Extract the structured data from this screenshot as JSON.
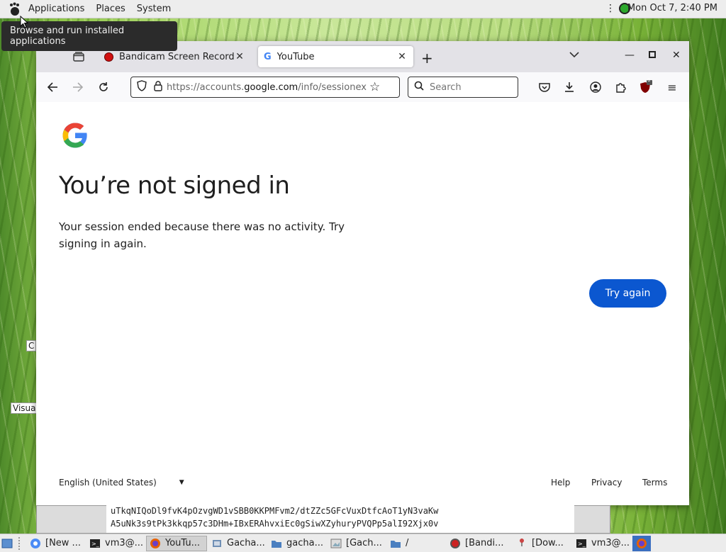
{
  "top_panel": {
    "menus": [
      "Applications",
      "Places",
      "System"
    ],
    "clock": "Mon Oct  7,  2:40 PM",
    "tooltip": "Browse and run installed applications"
  },
  "desktop": {
    "partial_labels": [
      "C",
      "Visua"
    ]
  },
  "browser": {
    "tabs": [
      {
        "title": "Bandicam Screen Recorder D",
        "icon": "bandicam-record-icon",
        "active": false
      },
      {
        "title": "YouTube",
        "icon": "google-g-icon",
        "active": true
      }
    ],
    "url_prefix": "https://accounts.",
    "url_domain": "google.com",
    "url_path": "/info/sessionexpired",
    "search_placeholder": "Search",
    "extension_badge": "6"
  },
  "page": {
    "heading": "You’re not signed in",
    "message": "Your session ended because there was no activity. Try signing in again.",
    "try_again": "Try again",
    "language": "English (United States)",
    "footer_links": [
      "Help",
      "Privacy",
      "Terms"
    ]
  },
  "terminal": {
    "lines": [
      "uTkqNIQoDl9fvK4pOzvgWD1vSBB0KKPMFvm2/dtZZc5GFcVuxDtfcAoT1yN3vaKw",
      "A5uNk3s9tPk3kkqp57c3DHm+IBxERAhvxiEc0gSiwXZyhuryPVQPp5alI92Xjx0v"
    ]
  },
  "taskbar": {
    "items": [
      {
        "label": "[New ...",
        "icon": "chrome-icon",
        "active": false
      },
      {
        "label": "vm3@...",
        "icon": "terminal-icon",
        "active": false
      },
      {
        "label": "YouTu...",
        "icon": "firefox-icon",
        "active": true
      },
      {
        "label": "Gacha...",
        "icon": "file-manager-icon",
        "active": false
      },
      {
        "label": "gacha...",
        "icon": "folder-icon",
        "active": false
      },
      {
        "label": "[Gach...",
        "icon": "image-viewer-icon",
        "active": false
      },
      {
        "label": "/",
        "icon": "folder-icon",
        "active": false
      },
      {
        "label": "[Bandi...",
        "icon": "bandicam-icon",
        "active": false
      },
      {
        "label": "[Dow...",
        "icon": "download-icon",
        "active": false
      },
      {
        "label": "vm3@...",
        "icon": "terminal-icon",
        "active": false
      }
    ]
  },
  "colors": {
    "google_blue_button": "#0b57d0",
    "panel": "#ededed"
  }
}
